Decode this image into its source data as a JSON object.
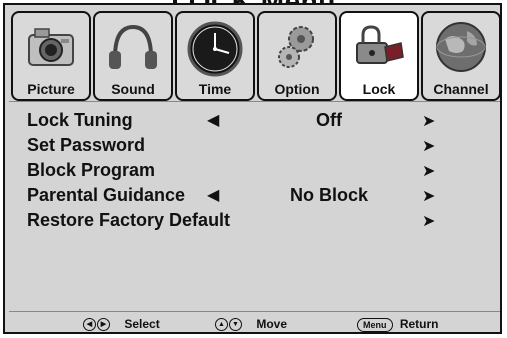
{
  "title": "LOCK Menu",
  "tabs": [
    {
      "label": "Picture",
      "icon": "camera-icon",
      "active": false
    },
    {
      "label": "Sound",
      "icon": "headphones-icon",
      "active": false
    },
    {
      "label": "Time",
      "icon": "clock-icon",
      "active": false
    },
    {
      "label": "Option",
      "icon": "gears-icon",
      "active": false
    },
    {
      "label": "Lock",
      "icon": "lock-icon",
      "active": true
    },
    {
      "label": "Channel",
      "icon": "globe-icon",
      "active": false
    }
  ],
  "menu_items": [
    {
      "label": "Lock Tuning",
      "value": "Off",
      "has_left_arrow": true
    },
    {
      "label": "Set Password",
      "value": "",
      "has_left_arrow": false
    },
    {
      "label": "Block Program",
      "value": "",
      "has_left_arrow": false
    },
    {
      "label": "Parental Guidance",
      "value": "No Block",
      "has_left_arrow": true
    },
    {
      "label": "Restore Factory Default",
      "value": "",
      "has_left_arrow": false
    }
  ],
  "arrows": {
    "left": "◀",
    "right": "➤"
  },
  "footer": {
    "select_label": "Select",
    "move_label": "Move",
    "menu_key": "Menu",
    "return_label": "Return"
  },
  "colors": {
    "background": "#d4d4d4",
    "active_tab": "#ffffff",
    "text": "#111111"
  }
}
